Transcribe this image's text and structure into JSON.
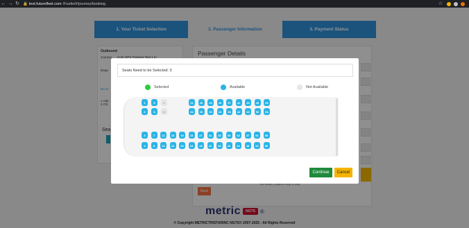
{
  "browser": {
    "url_host": "test.futurefleet.com",
    "url_path": "/Fuelio/#/journey/booking"
  },
  "steps": [
    {
      "label": "1. Your Ticket Selection"
    },
    {
      "label": "2. Passenger Information"
    },
    {
      "label": "3. Payment Status"
    }
  ],
  "journey": {
    "title": "Outbound",
    "journey_label": "Journey",
    "journey_value": "Cork GPS Tracking Test 1 to",
    "depart_label": "Depa",
    "no_label": "No of",
    "line1": "1 Adu",
    "line2": "2 Chi",
    "seats_label": "Sea"
  },
  "passenger": {
    "title": "Passenger Details",
    "back_label": "Back",
    "note": "*No seats, subject may to pay"
  },
  "footer": {
    "logo_word": "metric",
    "logo_badge": "NGTS",
    "logo_reg": "®",
    "copyright": "Copyright METRICTRISTARINC NGTS© 2007-2025 - All Rights Reserved"
  },
  "modal": {
    "seats_needed": "Seats Need to be Selected: 3",
    "legend": {
      "selected": "Selected",
      "available": "Available",
      "not_available": "Not Available",
      "selected_color": "#2ecc40",
      "available_color": "#2ab4e6",
      "not_available_color": "#e6e6e6"
    },
    "continue_label": "Continue",
    "cancel_label": "Cancel"
  },
  "seat_rows": [
    [
      "1",
      "5",
      "9",
      "21",
      "25",
      "29",
      "33",
      "37",
      "41",
      "45",
      "49",
      "53"
    ],
    [
      "2",
      "6",
      "10",
      "22",
      "26",
      "30",
      "34",
      "38",
      "42",
      "46",
      "50",
      "54"
    ],
    [
      "3",
      "7",
      "11",
      "15",
      "19",
      "23",
      "27",
      "31",
      "35",
      "39",
      "43",
      "47",
      "51",
      "55"
    ],
    [
      "4",
      "8",
      "12",
      "16",
      "20",
      "24",
      "28",
      "32",
      "36",
      "40",
      "44",
      "48",
      "52",
      "56"
    ]
  ],
  "seat_status": {
    "9": "na",
    "10": "na"
  }
}
